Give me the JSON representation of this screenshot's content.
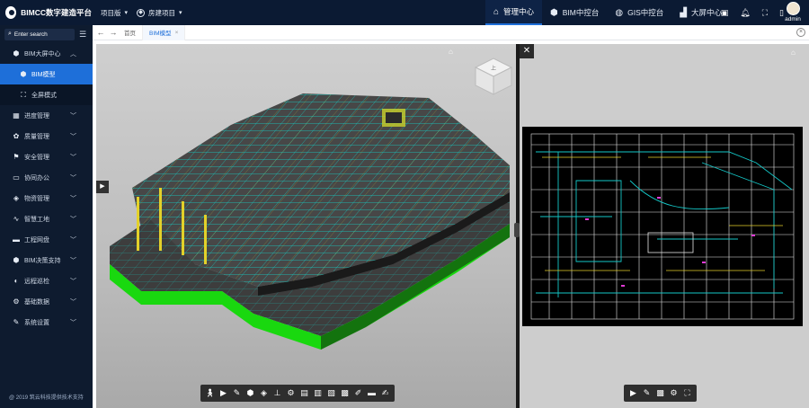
{
  "app": {
    "title": "BIMCC数字建造平台",
    "project_version_label": "项目版",
    "project_name": "房建项目"
  },
  "nav": {
    "items": [
      {
        "label": "管理中心",
        "icon": "home-icon",
        "active": true
      },
      {
        "label": "BIM中控台",
        "icon": "cube-icon",
        "active": false
      },
      {
        "label": "GIS中控台",
        "icon": "globe-icon",
        "active": false
      },
      {
        "label": "大屏中心",
        "icon": "chart-icon",
        "active": false
      }
    ]
  },
  "user": {
    "name": "admin"
  },
  "sidebar": {
    "search_placeholder": "Enter search",
    "items": [
      {
        "label": "BIM大屏中心",
        "icon": "cube-icon",
        "expanded": true
      },
      {
        "label": "BIM模型",
        "icon": "cube-icon",
        "sub": true,
        "active": true
      },
      {
        "label": "全屏模式",
        "icon": "fullscreen-icon",
        "sub": true
      },
      {
        "label": "进度管理",
        "icon": "calendar-icon"
      },
      {
        "label": "质量管理",
        "icon": "quality-icon"
      },
      {
        "label": "安全管理",
        "icon": "flag-icon"
      },
      {
        "label": "协同办公",
        "icon": "chat-icon"
      },
      {
        "label": "物资管理",
        "icon": "box-icon"
      },
      {
        "label": "智慧工地",
        "icon": "pulse-icon"
      },
      {
        "label": "工程网盘",
        "icon": "folder-icon"
      },
      {
        "label": "BIM决策支持",
        "icon": "cube-icon"
      },
      {
        "label": "远程巡检",
        "icon": "eye-icon"
      },
      {
        "label": "基础数据",
        "icon": "gear-icon"
      },
      {
        "label": "系统设置",
        "icon": "wrench-icon"
      }
    ],
    "copyright": "@ 2019 筑云科技提供技术支持"
  },
  "tabs": [
    {
      "label": "首页",
      "active": false
    },
    {
      "label": "BIM模型",
      "active": true
    }
  ],
  "viewcube": {
    "face": "上"
  },
  "colors": {
    "topbar": "#0b1a33",
    "sidebar": "#0e1b2f",
    "accent": "#1e6fd9",
    "model_green": "#19d80f",
    "model_cyan": "#14c7c7"
  }
}
